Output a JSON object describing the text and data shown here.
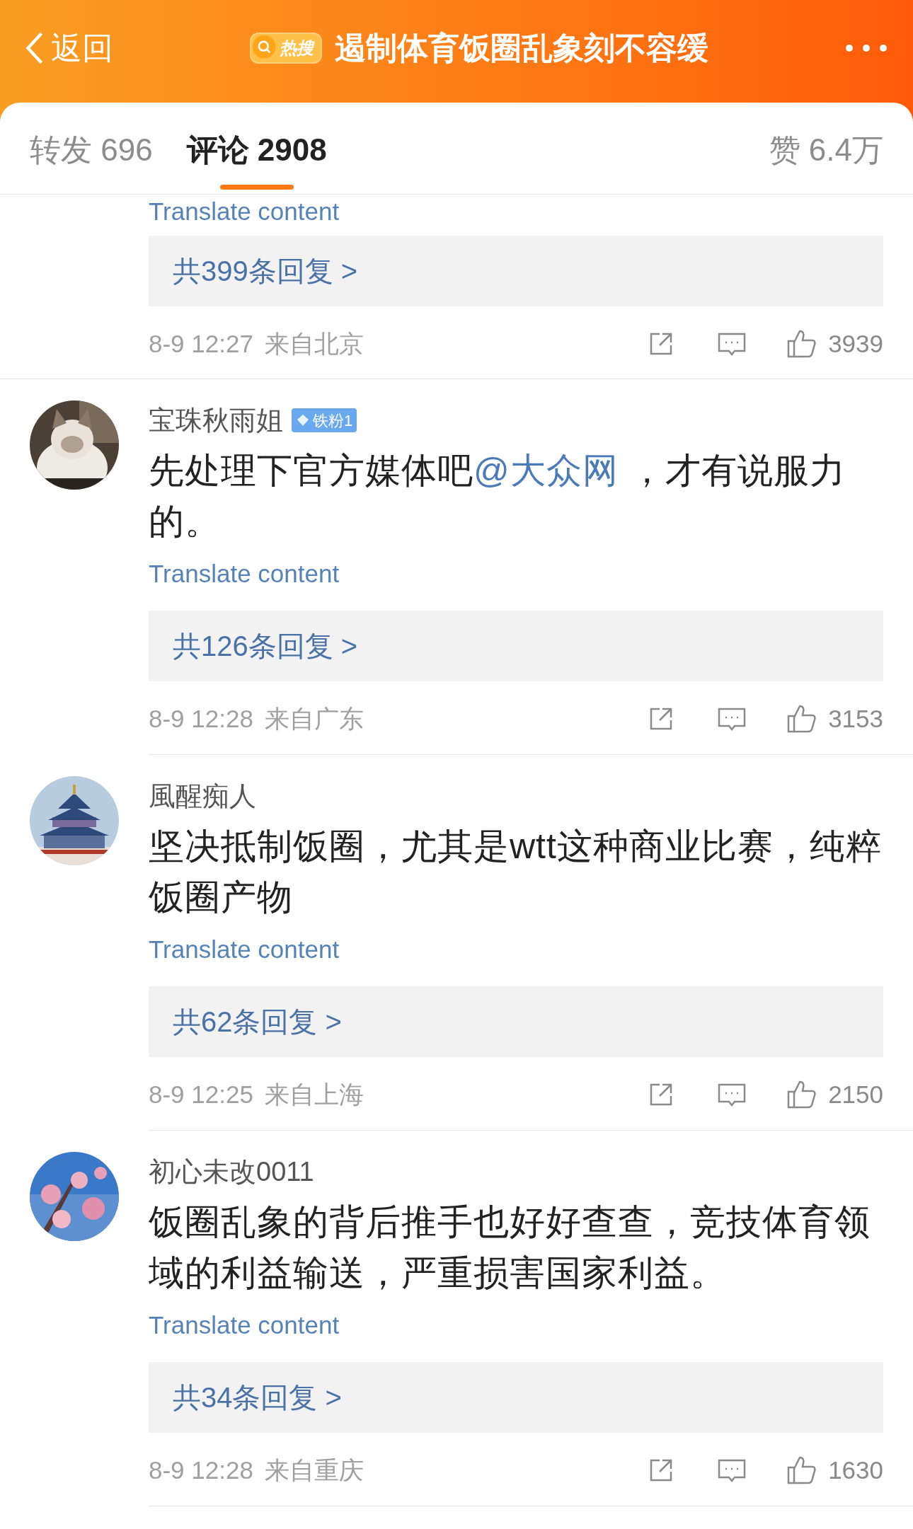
{
  "header": {
    "back_label": "返回",
    "hot_badge": "热搜",
    "title": "遏制体育饭圈乱象刻不容缓"
  },
  "tabs": [
    {
      "label": "转发 696",
      "selected": false
    },
    {
      "label": "评论 2908",
      "selected": true
    },
    {
      "label": "赞 6.4万",
      "selected": false
    }
  ],
  "comments": [
    {
      "kind": "cut_off",
      "translate": "Translate content",
      "replies": "共399条回复 >",
      "time": "8-9 12:27",
      "location": "来自北京",
      "likes": "3939"
    },
    {
      "avatar": {
        "kind": "picture"
      },
      "username": "宝珠秋雨姐",
      "badge": "铁粉1",
      "body": [
        {
          "kind": "text",
          "text": "先处理下官方媒体吧"
        },
        {
          "kind": "mention",
          "text": "@大众网"
        },
        {
          "kind": "text",
          "text": " ，才有说服力的。"
        }
      ],
      "translate": "Translate content",
      "replies": "共126条回复 >",
      "time": "8-9 12:28",
      "location": "来自广东",
      "likes": "3153"
    },
    {
      "avatar": {
        "kind": "picture"
      },
      "username": "風醒痴人",
      "body": [
        {
          "kind": "text",
          "text": "坚决抵制饭圈，尤其是wtt这种商业比赛，纯粹饭圈产物"
        }
      ],
      "translate": "Translate content",
      "replies": "共62条回复 >",
      "time": "8-9 12:25",
      "location": "来自上海",
      "likes": "2150"
    },
    {
      "avatar": {
        "kind": "picture"
      },
      "username": "初心未改0011",
      "body": [
        {
          "kind": "text",
          "text": "饭圈乱象的背后推手也好好查查，竞技体育领域的利益输送，严重损害国家利益。"
        }
      ],
      "translate": "Translate content",
      "replies": "共34条回复 >",
      "time": "8-9 12:28",
      "location": "来自重庆",
      "likes": "1630"
    }
  ]
}
